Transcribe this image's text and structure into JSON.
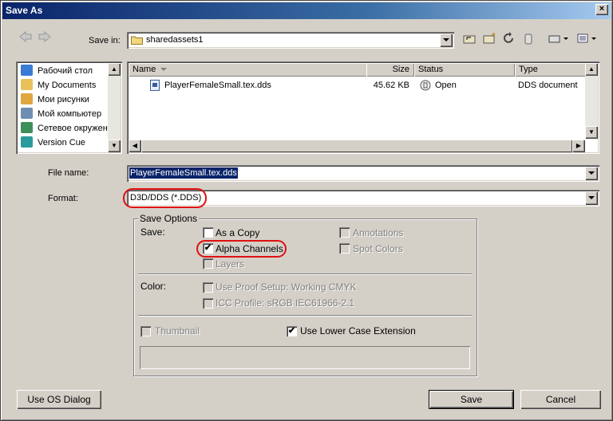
{
  "window": {
    "title": "Save As",
    "close_glyph": "×"
  },
  "toolbar": {
    "save_in_label": "Save in:",
    "folder": "sharedassets1",
    "icons": [
      "back-icon",
      "forward-icon",
      "up-folder-icon",
      "new-folder-icon",
      "refresh-icon",
      "delete-icon",
      "tools-icon",
      "views-icon"
    ]
  },
  "places": [
    {
      "label": "Рабочий стол",
      "icon": "desktop-icon",
      "color": "#3a7bd5"
    },
    {
      "label": "My Documents",
      "icon": "my-documents-icon",
      "color": "#e8c15a"
    },
    {
      "label": "Мои рисунки",
      "icon": "my-pictures-icon",
      "color": "#e0a640"
    },
    {
      "label": "Мой компьютер",
      "icon": "my-computer-icon",
      "color": "#6f8fb0"
    },
    {
      "label": "Сетевое окружен",
      "icon": "network-icon",
      "color": "#3f8f5a"
    },
    {
      "label": "Version Cue",
      "icon": "version-cue-icon",
      "color": "#2a9a9a"
    }
  ],
  "file_list": {
    "columns": [
      "Name",
      "Size",
      "Status",
      "Type"
    ],
    "rows": [
      {
        "name": "PlayerFemaleSmall.tex.dds",
        "size": "45.62 KB",
        "status": "Open",
        "type": "DDS document"
      }
    ]
  },
  "file_name": {
    "label": "File name:",
    "value": "PlayerFemaleSmall.tex.dds"
  },
  "format": {
    "label": "Format:",
    "value": "D3D/DDS (*.DDS)"
  },
  "save_options": {
    "title": "Save Options",
    "save_label": "Save:",
    "as_a_copy": {
      "label": "As a Copy",
      "checked": false,
      "enabled": true
    },
    "alpha_channels": {
      "label": "Alpha Channels",
      "checked": true,
      "enabled": true
    },
    "layers": {
      "label": "Layers",
      "checked": false,
      "enabled": false
    },
    "annotations": {
      "label": "Annotations",
      "checked": false,
      "enabled": false
    },
    "spot_colors": {
      "label": "Spot Colors",
      "checked": false,
      "enabled": false
    },
    "color_label": "Color:",
    "use_proof_setup": {
      "label": "Use Proof Setup:  Working CMYK",
      "checked": false,
      "enabled": false
    },
    "icc_profile": {
      "label": "ICC Profile:  sRGB IEC61966-2.1",
      "checked": false,
      "enabled": false
    },
    "thumbnail": {
      "label": "Thumbnail",
      "checked": false,
      "enabled": false
    },
    "lower_case_ext": {
      "label": "Use Lower Case Extension",
      "checked": true,
      "enabled": true
    }
  },
  "buttons": {
    "use_os_dialog": "Use OS Dialog",
    "save": "Save",
    "cancel": "Cancel"
  },
  "check_glyph": "✔",
  "colors": {
    "highlight": "#0a246a",
    "annotation_red": "#e01010"
  }
}
